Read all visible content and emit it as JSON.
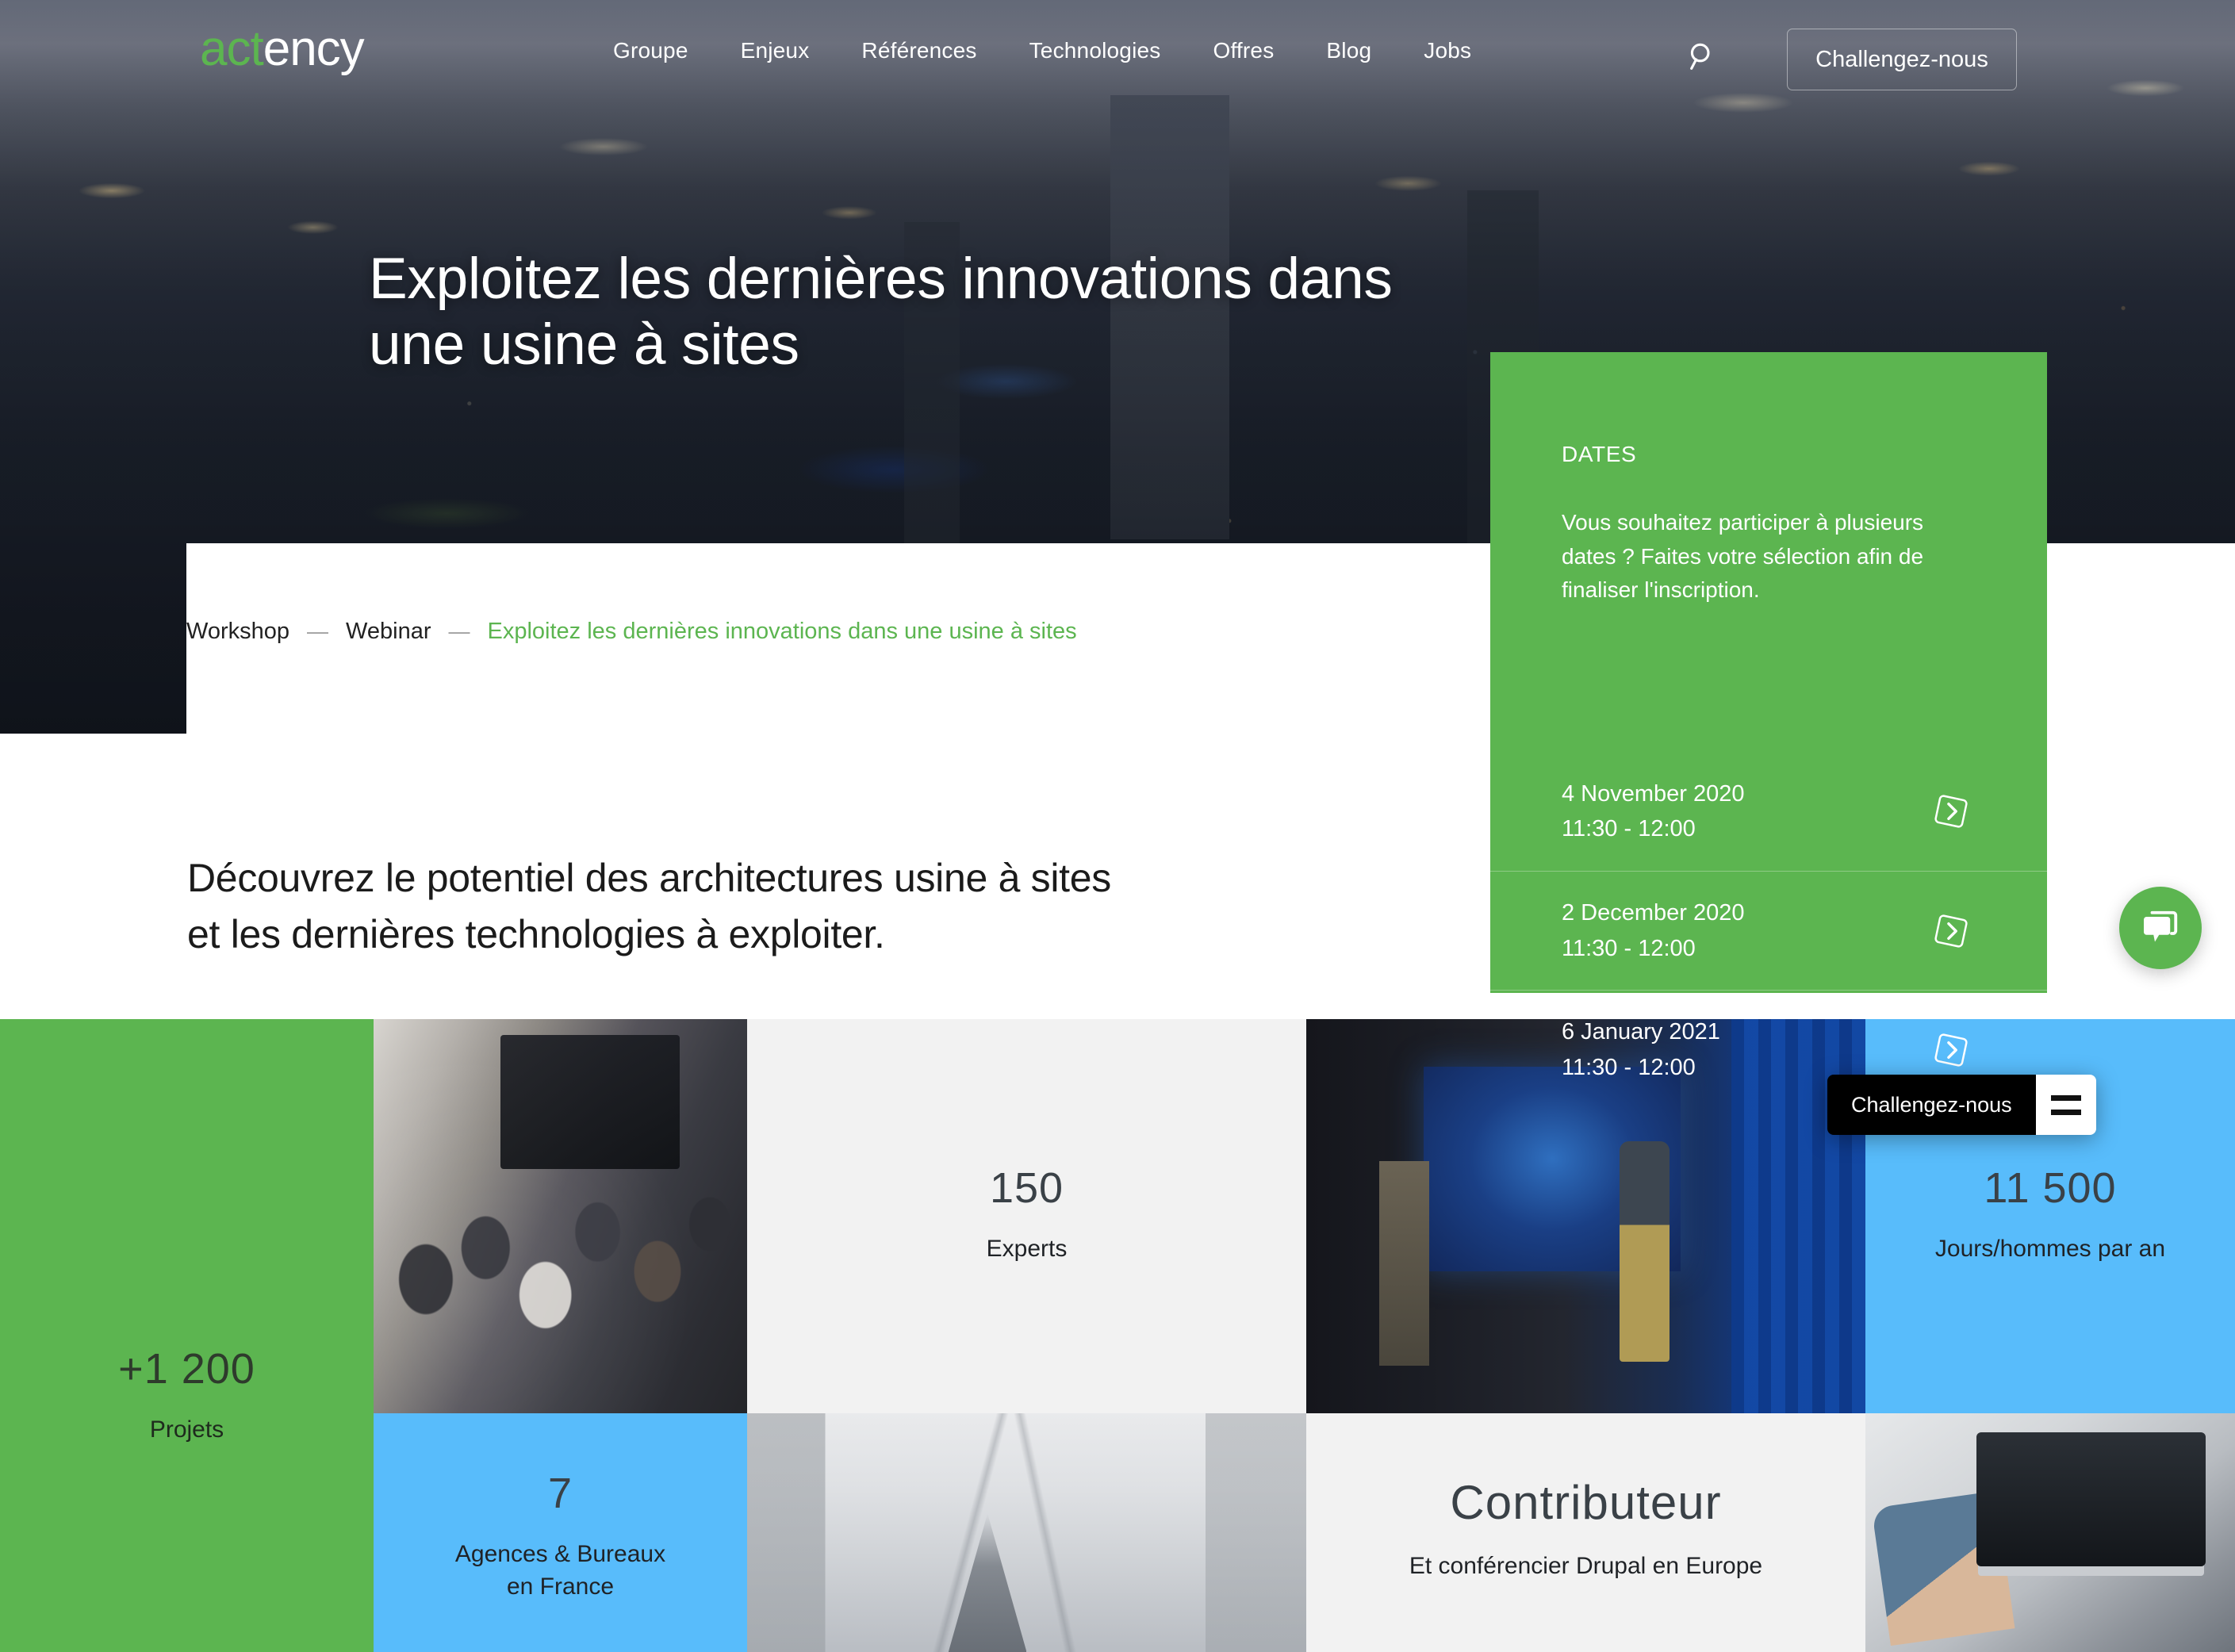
{
  "brand": {
    "name_green": "act",
    "name_white": "ency"
  },
  "header": {
    "nav": [
      {
        "label": "Groupe"
      },
      {
        "label": "Enjeux"
      },
      {
        "label": "Références"
      },
      {
        "label": "Technologies"
      },
      {
        "label": "Offres"
      },
      {
        "label": "Blog"
      },
      {
        "label": "Jobs"
      }
    ],
    "search_icon": "search-icon",
    "cta_label": "Challengez-nous"
  },
  "hero": {
    "title": "Exploitez les dernières innovations dans une usine à sites"
  },
  "breadcrumb": {
    "items": [
      {
        "label": "Workshop",
        "current": false
      },
      {
        "label": "Webinar",
        "current": false
      },
      {
        "label": "Exploitez les dernières innovations dans une usine à sites",
        "current": true
      }
    ],
    "separator": "—"
  },
  "dates_panel": {
    "label": "DATES",
    "description": "Vous souhaitez participer à plusieurs dates ? Faites votre sélection afin de finaliser l'inscription.",
    "accent_color": "#5cb550",
    "rows": [
      {
        "date": "4 November 2020",
        "time": "11:30 - 12:00",
        "icon": "chevron-right-diamond-icon"
      },
      {
        "date": "2 December 2020",
        "time": "11:30 - 12:00",
        "icon": "chevron-right-diamond-icon"
      },
      {
        "date": "6 January 2021",
        "time": "11:30 - 12:00",
        "icon": "chevron-right-diamond-icon"
      }
    ]
  },
  "intro": {
    "line1": "Découvrez le potentiel des architectures usine à sites",
    "line2": "et les dernières technologies à exploiter."
  },
  "stats": {
    "experts": {
      "number": "150",
      "label": "Experts"
    },
    "projets": {
      "number": "+1 200",
      "label": "Projets"
    },
    "jours": {
      "number": "11 500",
      "label": "Jours/hommes par an"
    },
    "agences": {
      "number": "7",
      "label": "Agences & Bureaux en France"
    },
    "contributeur": {
      "number": "Contributeur",
      "label": "Et conférencier Drupal en Europe"
    }
  },
  "colors": {
    "green": "#5cb550",
    "blue": "#58bcfb",
    "gray": "#f2f2f2",
    "black": "#000000"
  },
  "floating": {
    "challenge_label": "Challengez-nous",
    "menu_icon": "hamburger-icon",
    "chat_icon": "chat-bubble-icon"
  }
}
